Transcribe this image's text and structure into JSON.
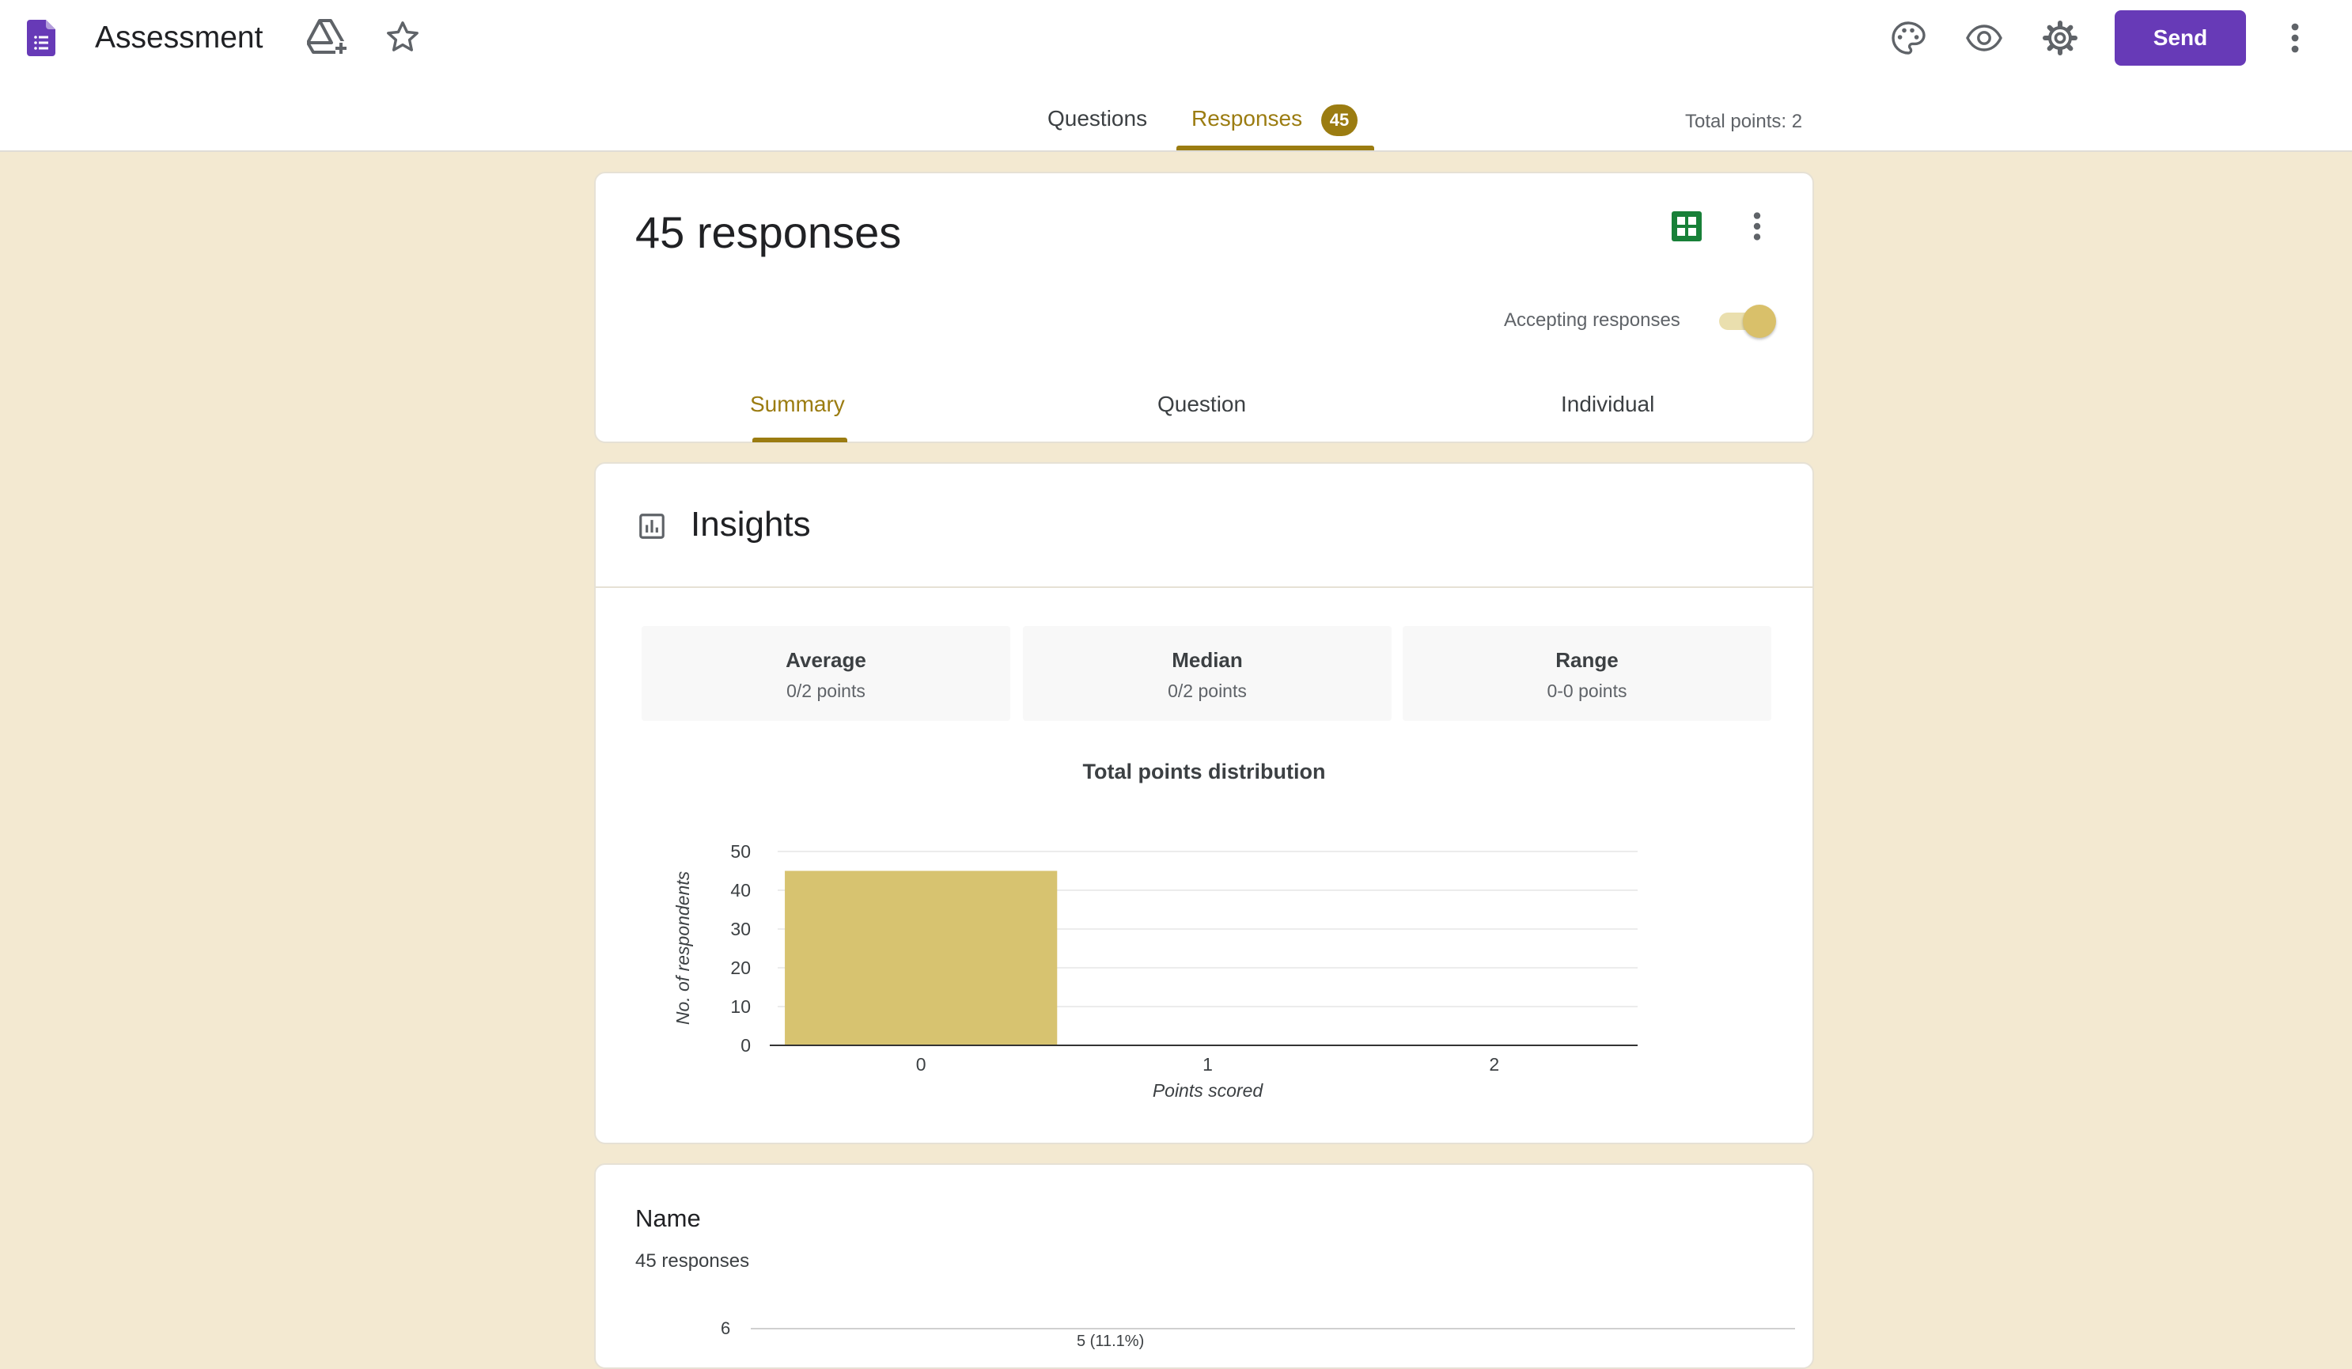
{
  "app": {
    "title": "Assessment",
    "send_label": "Send",
    "icons": [
      "forms-icon",
      "drive-add-icon",
      "star-icon",
      "palette-icon",
      "eye-icon",
      "gear-icon",
      "more-vert-icon"
    ],
    "accent_color": "#673ab7",
    "theme_color": "#9b7c11"
  },
  "tabs": {
    "questions": "Questions",
    "responses": "Responses",
    "responses_count": "45",
    "total_points": "Total points: 2"
  },
  "responses_card": {
    "count_label": "45 responses",
    "accepting_label": "Accepting responses",
    "accepting": true,
    "subtabs": [
      "Summary",
      "Question",
      "Individual"
    ],
    "active_subtab": "Summary"
  },
  "insights": {
    "title": "Insights",
    "stats": [
      {
        "label": "Average",
        "value": "0/2 points"
      },
      {
        "label": "Median",
        "value": "0/2 points"
      },
      {
        "label": "Range",
        "value": "0-0 points"
      }
    ]
  },
  "chart_data": {
    "type": "bar",
    "title": "Total points distribution",
    "xlabel": "Points scored",
    "ylabel": "No. of respondents",
    "categories": [
      "0",
      "1",
      "2"
    ],
    "values": [
      45,
      0,
      0
    ],
    "ylim": [
      0,
      50
    ],
    "yticks": [
      0,
      10,
      20,
      30,
      40,
      50
    ],
    "grid": true,
    "bar_color": "#d7c370"
  },
  "name_section": {
    "title": "Name",
    "count_label": "45 responses",
    "axis_tick": "6",
    "bar_label": "5 (11.1%)"
  }
}
